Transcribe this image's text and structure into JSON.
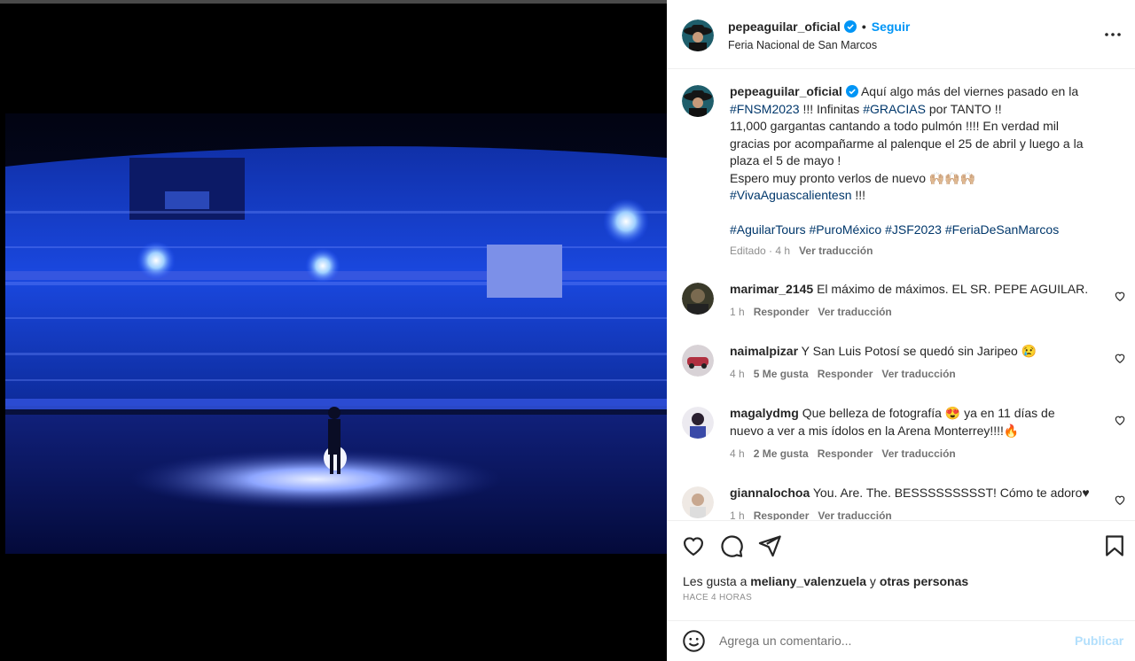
{
  "post": {
    "author": "pepeaguilar_oficial",
    "follow_label": "Seguir",
    "dot": "•",
    "location": "Feria Nacional de San Marcos",
    "caption": {
      "username": "pepeaguilar_oficial",
      "line1_text": "Aquí algo más del viernes pasado en la",
      "tag1": "#FNSM2023",
      "line2_mid": "!!! Infinitas",
      "tag2": "#GRACIAS",
      "line2_end": "por TANTO !!",
      "line3": "11,000 gargantas cantando a todo pulmón !!!! En verdad mil",
      "line4": "gracias por acompañarme al palenque el 25 de abril y luego a la",
      "line5": "plaza el 5 de mayo !",
      "line6": "Espero muy pronto verlos de nuevo 🙌🏼🙌🏼🙌🏼",
      "tag3": "#VivaAguascalientesn",
      "line7_end": "!!!",
      "hashtags": [
        "#AguilarTours",
        "#PuroMéxico",
        "#JSF2023",
        "#FeriaDeSanMarcos"
      ],
      "meta_edited": "Editado · 4 h",
      "meta_translate": "Ver traducción"
    }
  },
  "comments": [
    {
      "username": "marimar_2145",
      "text": "El máximo de máximos. EL SR. PEPE AGUILAR.",
      "time": "1 h",
      "likes": "",
      "reply": "Responder",
      "translate": "Ver traducción"
    },
    {
      "username": "naimalpizar",
      "text": "Y San Luis Potosí se quedó sin Jaripeo 😢",
      "time": "4 h",
      "likes": "5 Me gusta",
      "reply": "Responder",
      "translate": "Ver traducción"
    },
    {
      "username": "magalydmg",
      "text": "Que belleza de fotografía 😍 ya en 11 días de",
      "text2": "nuevo a ver a mis ídolos en la Arena Monterrey!!!!🔥",
      "time": "4 h",
      "likes": "2 Me gusta",
      "reply": "Responder",
      "translate": "Ver traducción"
    },
    {
      "username": "giannalochoa",
      "text": "You. Are. The. BESSSSSSSSST! Cómo te adoro♥",
      "time": "1 h",
      "likes": "",
      "reply": "Responder",
      "translate": "Ver traducción"
    }
  ],
  "likes": {
    "prefix": "Les gusta a",
    "user": "meliany_valenzuela",
    "connector": "y",
    "others": "otras personas",
    "time_ago": "HACE 4 HORAS"
  },
  "comment_box": {
    "placeholder": "Agrega un comentario...",
    "publish_label": "Publicar"
  },
  "icons": {
    "more": "more-horizontal-icon",
    "like": "heart-icon",
    "comment": "comment-bubble-icon",
    "share": "paper-plane-icon",
    "save": "bookmark-icon",
    "emoji": "emoji-icon",
    "verified": "verified-badge-icon"
  },
  "colors": {
    "accent": "#0095f6",
    "hashtag": "#00376b",
    "publish_disabled": "#b2dffc",
    "verified": "#0095f6"
  }
}
